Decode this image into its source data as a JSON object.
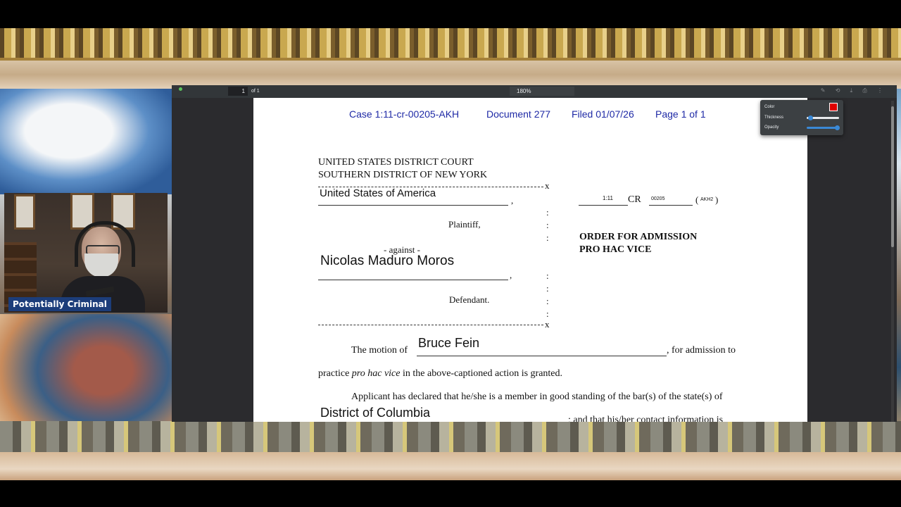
{
  "stream": {
    "presenter_label": "Potentially Criminal"
  },
  "viewer": {
    "current_page": "1",
    "page_of": "of 1",
    "zoom": "180%",
    "annotation_popup": {
      "color_label": "Color",
      "color_value": "#e00000",
      "thickness_label": "Thickness",
      "thickness_value": 0.1,
      "opacity_label": "Opacity",
      "opacity_value": 1.0
    }
  },
  "document": {
    "header": {
      "case": "Case 1:11-cr-00205-AKH",
      "document": "Document 277",
      "filed": "Filed 01/07/26",
      "page": "Page 1 of 1"
    },
    "court_line1": "UNITED STATES DISTRICT COURT",
    "court_line2": "SOUTHERN DISTRICT OF NEW YORK",
    "plaintiff_name": "United States of America",
    "comma": ",",
    "plaintiff_label": "Plaintiff,",
    "against": "- against -",
    "defendant_name": "Nicolas Maduro Moros",
    "defendant_label": "Defendant.",
    "x_mark": "x",
    "case_num_a": "1:11",
    "cr": "CR",
    "case_num_b": "00205",
    "judge": "AKH2",
    "order_title_1": "ORDER FOR ADMISSION",
    "order_title_2": "PRO HAC VICE",
    "motion_prefix": "The motion of",
    "applicant": "Bruce Fein",
    "motion_suffix": ", for admission to",
    "practice_prefix": "practice",
    "practice_italic": "pro hac vice",
    "practice_suffix": "in the above-captioned action is granted.",
    "applicant_declared": "Applicant has declared that he/she is a member in good standing of the bar(s) of the state(s) of",
    "bar_state": "District of Columbia",
    "contact_text": "; and that his/her contact information is"
  }
}
